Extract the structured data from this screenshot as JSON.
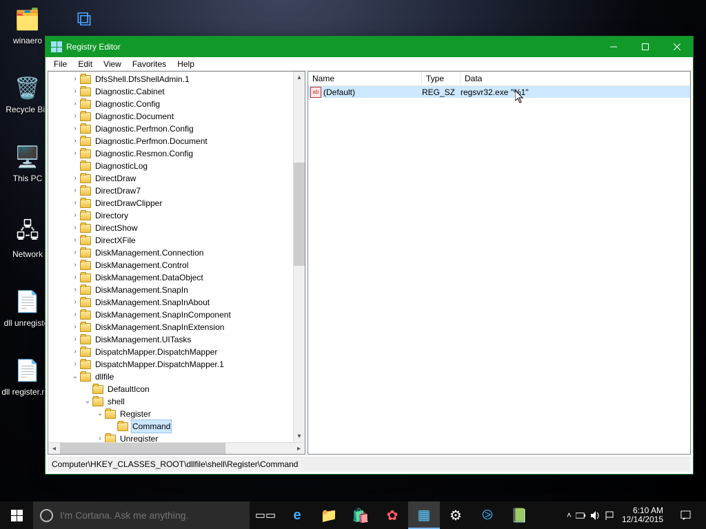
{
  "desktop_icons": [
    {
      "name": "winaero",
      "label": "winaero"
    },
    {
      "name": "scripts",
      "label": ""
    },
    {
      "name": "recycle-bin",
      "label": "Recycle Bin"
    },
    {
      "name": "this-pc",
      "label": "This PC"
    },
    {
      "name": "network",
      "label": "Network"
    },
    {
      "name": "dll-unregister",
      "label": "dll unregister"
    },
    {
      "name": "dll-register",
      "label": "dll register.reg"
    }
  ],
  "window": {
    "title": "Registry Editor",
    "menu": [
      "File",
      "Edit",
      "View",
      "Favorites",
      "Help"
    ],
    "statusbar": "Computer\\HKEY_CLASSES_ROOT\\dllfile\\shell\\Register\\Command"
  },
  "tree": [
    {
      "indent": 0,
      "exp": ">",
      "label": "DfsShell.DfsShellAdmin.1"
    },
    {
      "indent": 0,
      "exp": ">",
      "label": "Diagnostic.Cabinet"
    },
    {
      "indent": 0,
      "exp": ">",
      "label": "Diagnostic.Config"
    },
    {
      "indent": 0,
      "exp": ">",
      "label": "Diagnostic.Document"
    },
    {
      "indent": 0,
      "exp": ">",
      "label": "Diagnostic.Perfmon.Config"
    },
    {
      "indent": 0,
      "exp": ">",
      "label": "Diagnostic.Perfmon.Document"
    },
    {
      "indent": 0,
      "exp": ">",
      "label": "Diagnostic.Resmon.Config"
    },
    {
      "indent": 0,
      "exp": "",
      "label": "DiagnosticLog"
    },
    {
      "indent": 0,
      "exp": ">",
      "label": "DirectDraw"
    },
    {
      "indent": 0,
      "exp": ">",
      "label": "DirectDraw7"
    },
    {
      "indent": 0,
      "exp": ">",
      "label": "DirectDrawClipper"
    },
    {
      "indent": 0,
      "exp": ">",
      "label": "Directory"
    },
    {
      "indent": 0,
      "exp": ">",
      "label": "DirectShow"
    },
    {
      "indent": 0,
      "exp": ">",
      "label": "DirectXFile"
    },
    {
      "indent": 0,
      "exp": ">",
      "label": "DiskManagement.Connection"
    },
    {
      "indent": 0,
      "exp": ">",
      "label": "DiskManagement.Control"
    },
    {
      "indent": 0,
      "exp": ">",
      "label": "DiskManagement.DataObject"
    },
    {
      "indent": 0,
      "exp": ">",
      "label": "DiskManagement.SnapIn"
    },
    {
      "indent": 0,
      "exp": ">",
      "label": "DiskManagement.SnapInAbout"
    },
    {
      "indent": 0,
      "exp": ">",
      "label": "DiskManagement.SnapInComponent"
    },
    {
      "indent": 0,
      "exp": ">",
      "label": "DiskManagement.SnapInExtension"
    },
    {
      "indent": 0,
      "exp": ">",
      "label": "DiskManagement.UITasks"
    },
    {
      "indent": 0,
      "exp": ">",
      "label": "DispatchMapper.DispatchMapper"
    },
    {
      "indent": 0,
      "exp": ">",
      "label": "DispatchMapper.DispatchMapper.1"
    },
    {
      "indent": 0,
      "exp": "v",
      "label": "dllfile"
    },
    {
      "indent": 1,
      "exp": "",
      "label": "DefaultIcon"
    },
    {
      "indent": 1,
      "exp": "v",
      "label": "shell"
    },
    {
      "indent": 2,
      "exp": "v",
      "label": "Register"
    },
    {
      "indent": 3,
      "exp": "",
      "label": "Command",
      "selected": true
    },
    {
      "indent": 2,
      "exp": ">",
      "label": "Unregister"
    }
  ],
  "list": {
    "headers": {
      "name": "Name",
      "type": "Type",
      "data": "Data"
    },
    "rows": [
      {
        "name": "(Default)",
        "type": "REG_SZ",
        "data": "regsvr32.exe \"%1\"",
        "selected": true
      }
    ]
  },
  "taskbar": {
    "search_placeholder": "I'm Cortana. Ask me anything.",
    "time": "6:10 AM",
    "date": "12/14/2015"
  }
}
